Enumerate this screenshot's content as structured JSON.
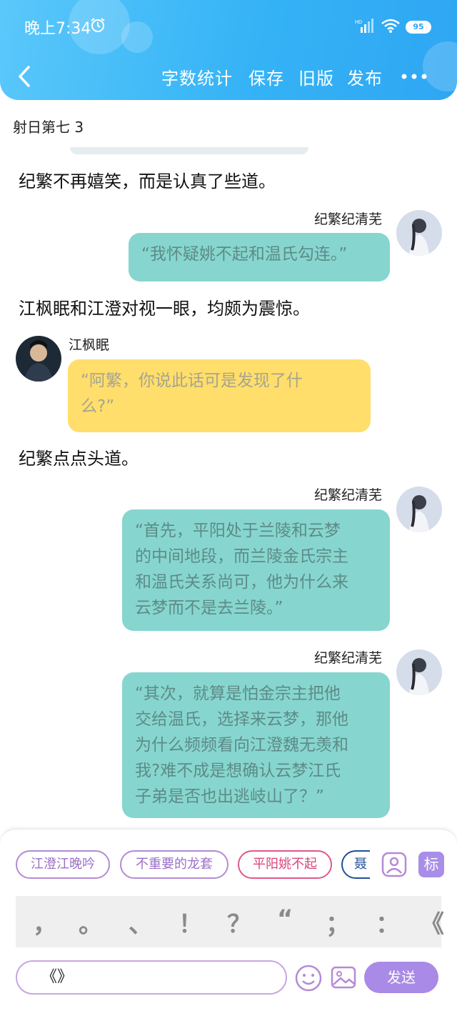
{
  "status_bar": {
    "time": "晚上7:34",
    "battery": "95"
  },
  "header": {
    "nav": [
      "字数统计",
      "保存",
      "旧版",
      "发布"
    ]
  },
  "doc": {
    "title": "射日第七 3"
  },
  "messages": [
    {
      "type": "narration",
      "text": "纪繁不再嬉笑，而是认真了些道。"
    },
    {
      "type": "chat",
      "speaker": "纪繁纪清芜",
      "text": "“我怀疑姚不起和温氏勾连。”"
    },
    {
      "type": "narration",
      "text": "江枫眠和江澄对视一眼，均颇为震惊。"
    },
    {
      "type": "chat",
      "speaker": "江枫眠",
      "line1": "“阿繁，你说此话可是发现了什",
      "line2": "么?”"
    },
    {
      "type": "narration",
      "text": "纪繁点点头道。"
    },
    {
      "type": "chat",
      "speaker": "纪繁纪清芜",
      "lines": [
        "“首先，平阳处于兰陵和云梦",
        "的中间地段，而兰陵金氏宗主",
        "和温氏关系尚可，他为什么来",
        "云梦而不是去兰陵。”"
      ]
    },
    {
      "type": "chat",
      "speaker": "纪繁纪清芜",
      "lines": [
        "“其次，就算是怕金宗主把他",
        "交给温氏，选择来云梦，那他",
        "为什么频频看向江澄魏无羡和",
        "我?难不成是想确认云梦江氏",
        "子弟是否也出逃岐山了？”"
      ]
    }
  ],
  "tags": [
    "江澄江晚吟",
    "不重要的龙套",
    "平阳姚不起",
    "聂"
  ],
  "tag_colors": [
    "#b48ad6",
    "#b48ad6",
    "#e0578a",
    "#1f4f9a"
  ],
  "biao_label": "标",
  "punctuation": [
    "，",
    "。",
    "、",
    "！",
    "？",
    "“",
    "；",
    "：",
    "《"
  ],
  "input": {
    "value": "《》"
  },
  "send_label": "发送",
  "icons": [
    "alarm-icon",
    "signal-icon",
    "wifi-icon",
    "back-icon",
    "more-icon",
    "contact-icon",
    "emoji-icon",
    "image-icon"
  ],
  "colors": {
    "header": "#35b3f6",
    "teal_bubble": "#86d6cf",
    "yellow_bubble": "#ffde6b",
    "send": "#a98ae6"
  }
}
